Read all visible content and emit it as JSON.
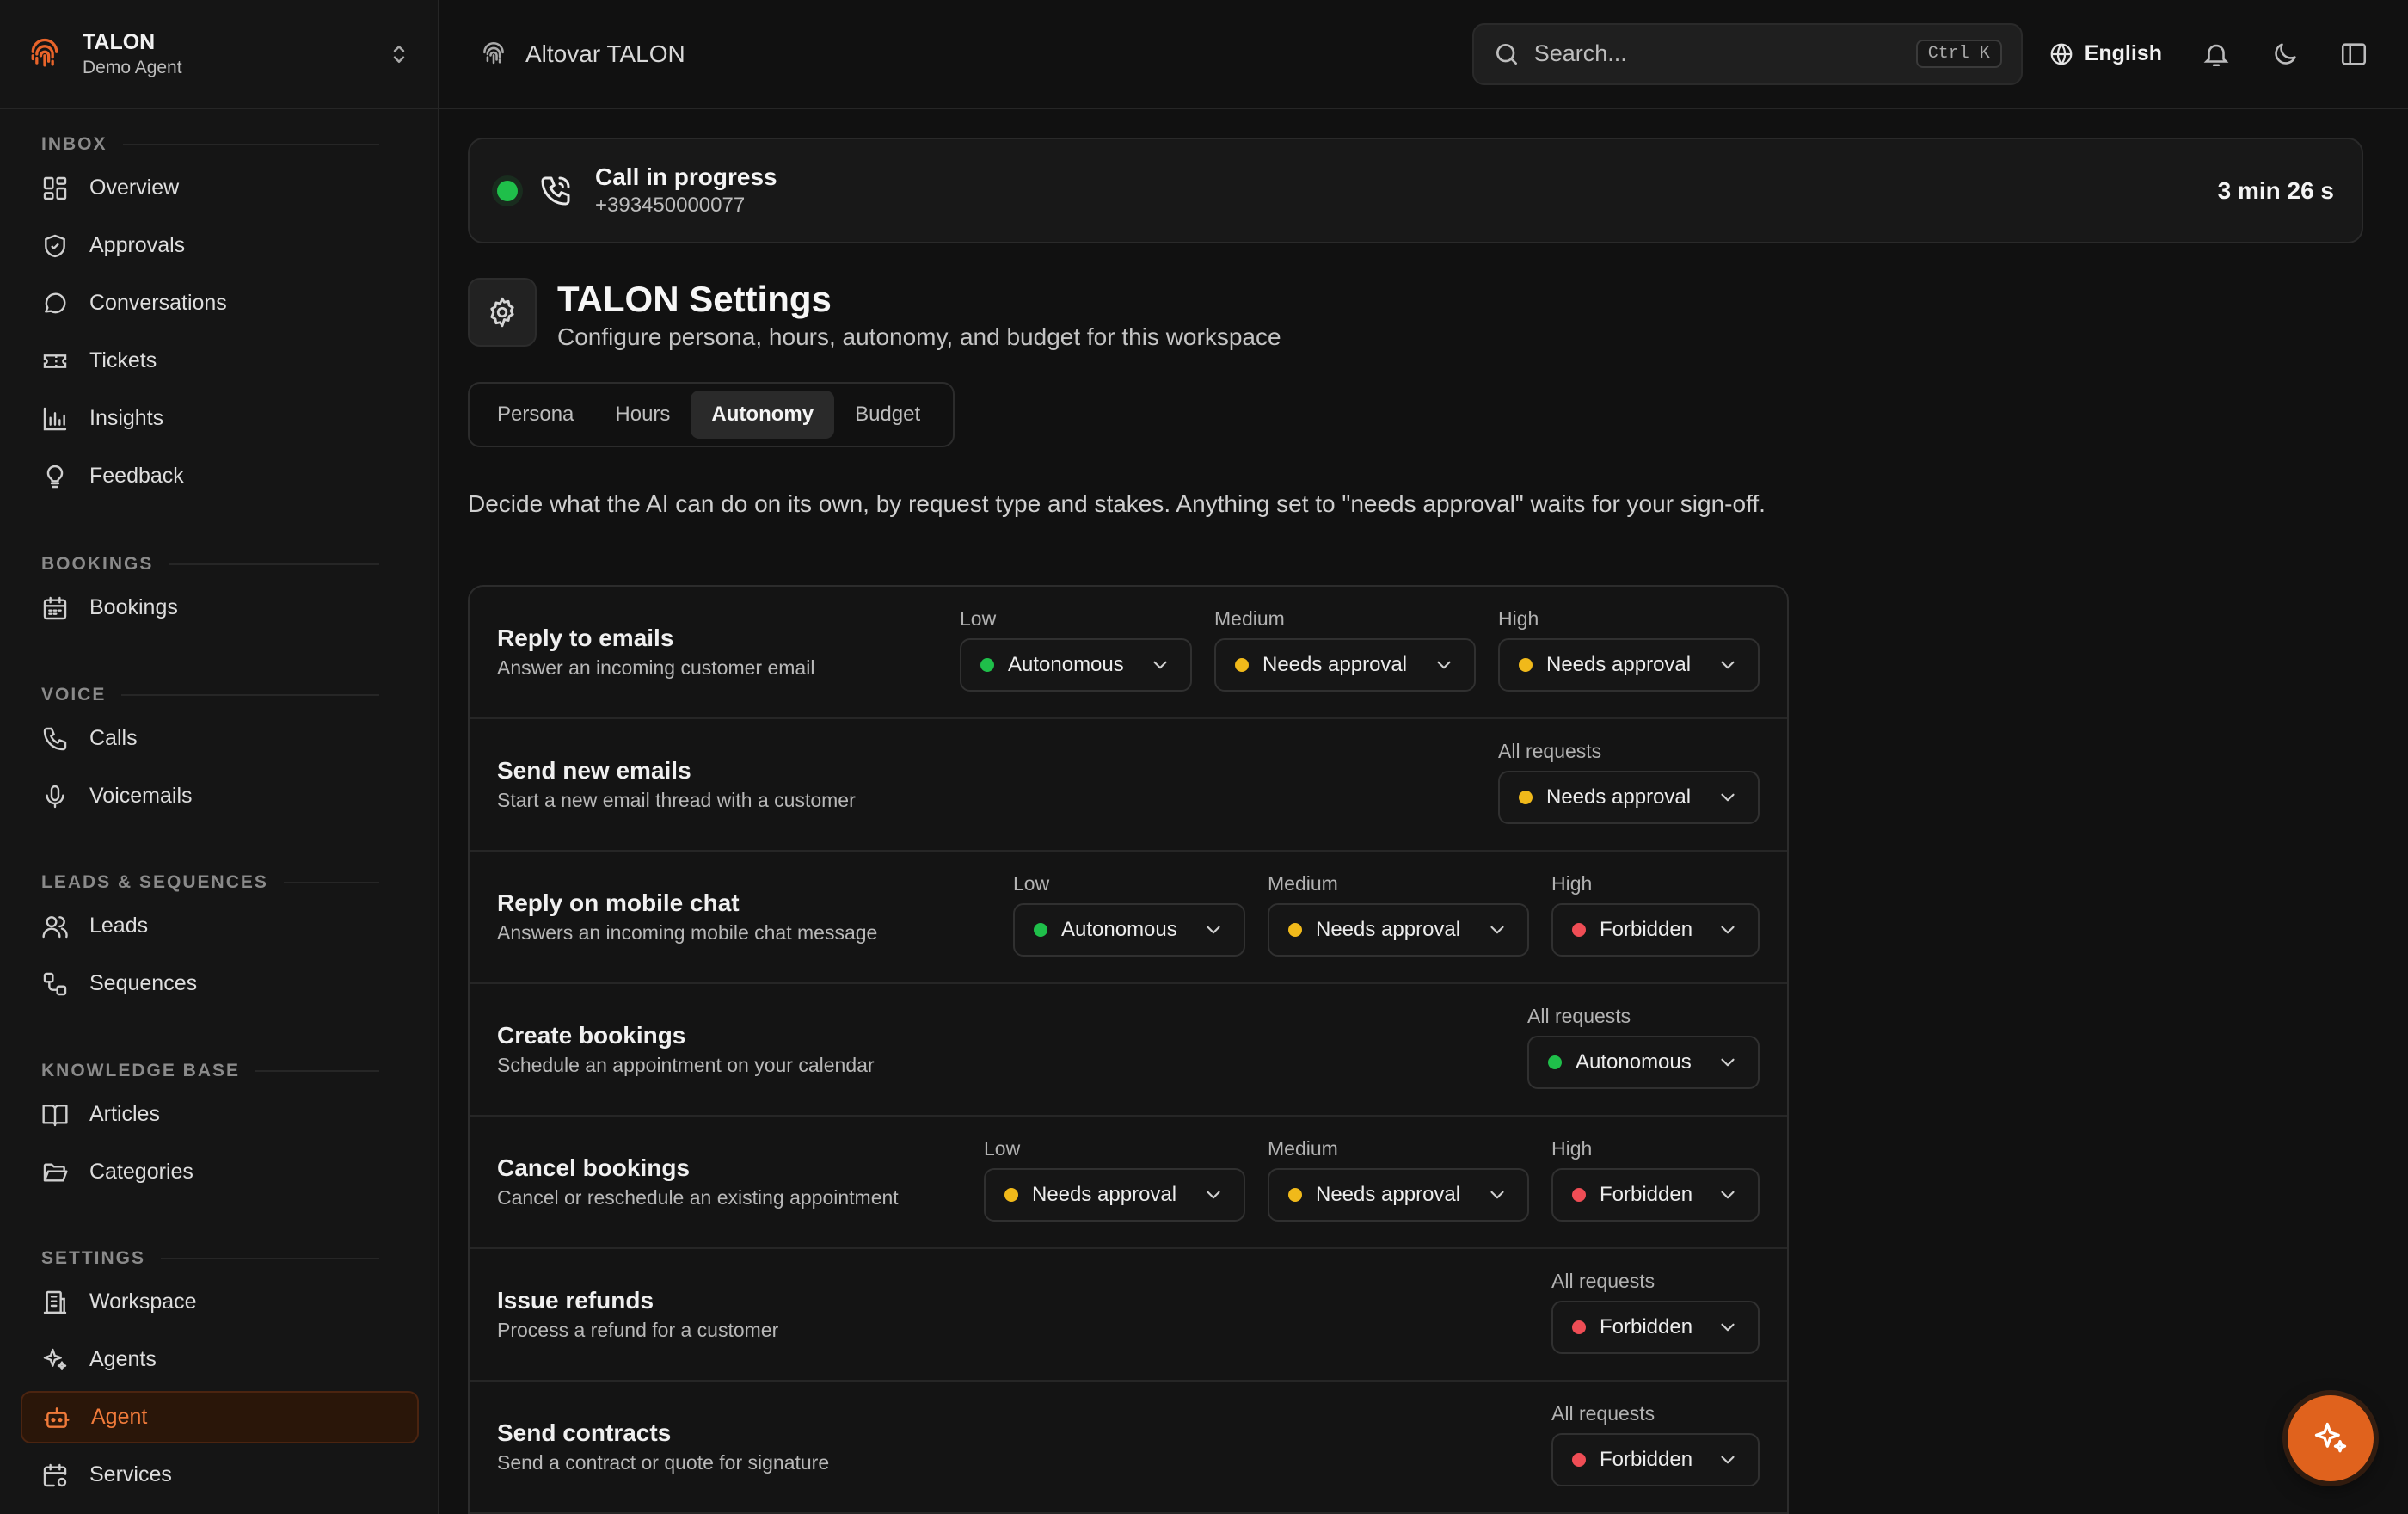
{
  "brand": {
    "name": "TALON",
    "subtitle": "Demo Agent"
  },
  "sidebar": {
    "sections": [
      {
        "heading": "INBOX",
        "items": [
          {
            "label": "Overview",
            "icon": "grid-icon"
          },
          {
            "label": "Approvals",
            "icon": "shield-check-icon"
          },
          {
            "label": "Conversations",
            "icon": "chat-bubble-icon"
          },
          {
            "label": "Tickets",
            "icon": "ticket-icon"
          },
          {
            "label": "Insights",
            "icon": "bar-chart-icon"
          },
          {
            "label": "Feedback",
            "icon": "lightbulb-icon"
          }
        ]
      },
      {
        "heading": "BOOKINGS",
        "items": [
          {
            "label": "Bookings",
            "icon": "calendar-icon"
          }
        ]
      },
      {
        "heading": "VOICE",
        "items": [
          {
            "label": "Calls",
            "icon": "phone-icon"
          },
          {
            "label": "Voicemails",
            "icon": "microphone-icon"
          }
        ]
      },
      {
        "heading": "LEADS & SEQUENCES",
        "items": [
          {
            "label": "Leads",
            "icon": "users-icon"
          },
          {
            "label": "Sequences",
            "icon": "workflow-icon"
          }
        ]
      },
      {
        "heading": "KNOWLEDGE BASE",
        "items": [
          {
            "label": "Articles",
            "icon": "book-open-icon"
          },
          {
            "label": "Categories",
            "icon": "folder-open-icon"
          }
        ]
      },
      {
        "heading": "SETTINGS",
        "items": [
          {
            "label": "Workspace",
            "icon": "building-icon"
          },
          {
            "label": "Agents",
            "icon": "sparkles-icon"
          },
          {
            "label": "Agent",
            "icon": "bot-icon",
            "active": true
          },
          {
            "label": "Services",
            "icon": "calendar-cog-icon"
          }
        ]
      }
    ]
  },
  "topbar": {
    "app_name": "Altovar TALON",
    "search_placeholder": "Search...",
    "search_shortcut": "Ctrl K",
    "language": "English"
  },
  "call": {
    "status": "Call in progress",
    "number": "+393450000077",
    "duration": "3 min 26 s"
  },
  "settings": {
    "title": "TALON Settings",
    "subtitle": "Configure persona, hours, autonomy, and budget for this workspace",
    "tabs": [
      "Persona",
      "Hours",
      "Autonomy",
      "Budget"
    ],
    "active_tab": "Autonomy",
    "intro": "Decide what the AI can do on its own, by request type and stakes. Anything set to \"needs approval\" waits for your sign-off."
  },
  "autonomy_rules": [
    {
      "title": "Reply to emails",
      "desc": "Answer an incoming customer email",
      "levels": [
        {
          "label": "Low",
          "value": "Autonomous",
          "status": "green"
        },
        {
          "label": "Medium",
          "value": "Needs approval",
          "status": "yellow"
        },
        {
          "label": "High",
          "value": "Needs approval",
          "status": "yellow"
        }
      ]
    },
    {
      "title": "Send new emails",
      "desc": "Start a new email thread with a customer",
      "levels": [
        {
          "label": "All requests",
          "value": "Needs approval",
          "status": "yellow"
        }
      ]
    },
    {
      "title": "Reply on mobile chat",
      "desc": "Answers an incoming mobile chat message",
      "levels": [
        {
          "label": "Low",
          "value": "Autonomous",
          "status": "green"
        },
        {
          "label": "Medium",
          "value": "Needs approval",
          "status": "yellow"
        },
        {
          "label": "High",
          "value": "Forbidden",
          "status": "red"
        }
      ]
    },
    {
      "title": "Create bookings",
      "desc": "Schedule an appointment on your calendar",
      "levels": [
        {
          "label": "All requests",
          "value": "Autonomous",
          "status": "green"
        }
      ]
    },
    {
      "title": "Cancel bookings",
      "desc": "Cancel or reschedule an existing appointment",
      "levels": [
        {
          "label": "Low",
          "value": "Needs approval",
          "status": "yellow"
        },
        {
          "label": "Medium",
          "value": "Needs approval",
          "status": "yellow"
        },
        {
          "label": "High",
          "value": "Forbidden",
          "status": "red"
        }
      ]
    },
    {
      "title": "Issue refunds",
      "desc": "Process a refund for a customer",
      "levels": [
        {
          "label": "All requests",
          "value": "Forbidden",
          "status": "red"
        }
      ]
    },
    {
      "title": "Send contracts",
      "desc": "Send a contract or quote for signature",
      "levels": [
        {
          "label": "All requests",
          "value": "Forbidden",
          "status": "red"
        }
      ]
    }
  ],
  "colors": {
    "accent": "#e0621d",
    "green": "#1fbf4a",
    "yellow": "#f0b91a",
    "red": "#ef4d55"
  }
}
